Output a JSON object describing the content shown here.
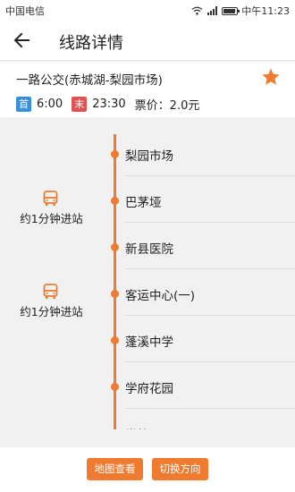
{
  "status_bar": {
    "carrier": "中国电信",
    "time": "中午11:23"
  },
  "header": {
    "title": "线路详情"
  },
  "route": {
    "name": "一路公交(赤城湖-梨园市场)",
    "first_badge": "首",
    "first_time": "6:00",
    "last_badge": "末",
    "last_time": "23:30",
    "fare": "票价：2.0元"
  },
  "stops": [
    {
      "name": "梨园市场"
    },
    {
      "name": "巴茅垭"
    },
    {
      "name": "新县医院"
    },
    {
      "name": "客运中心(一)"
    },
    {
      "name": "蓬溪中学"
    },
    {
      "name": "学府花园"
    },
    {
      "name": "党校"
    }
  ],
  "buses": [
    {
      "eta": "约1分钟进站"
    },
    {
      "eta": "约1分钟进站"
    }
  ],
  "actions": {
    "map": "地图查看",
    "switch": "切换方向"
  },
  "colors": {
    "accent": "#ee7b30",
    "first_badge": "#3a8fd8",
    "last_badge": "#e05353"
  }
}
